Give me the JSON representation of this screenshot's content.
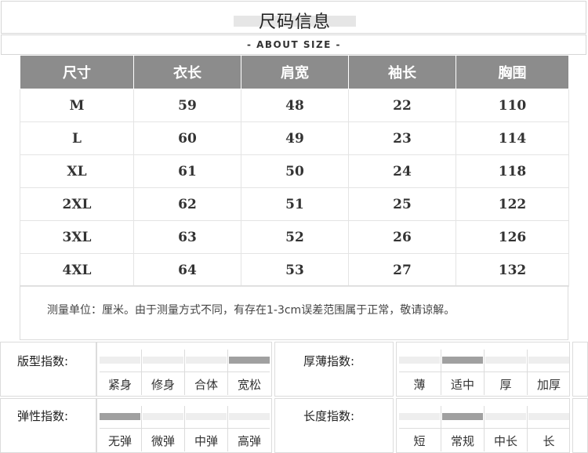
{
  "header": {
    "title": "尺码信息",
    "subtitle": "- ABOUT SIZE -"
  },
  "table": {
    "columns": [
      "尺寸",
      "衣长",
      "肩宽",
      "袖长",
      "胸围"
    ],
    "rows": [
      [
        "M",
        "59",
        "48",
        "22",
        "110"
      ],
      [
        "L",
        "60",
        "49",
        "23",
        "114"
      ],
      [
        "XL",
        "61",
        "50",
        "24",
        "118"
      ],
      [
        "2XL",
        "62",
        "51",
        "25",
        "122"
      ],
      [
        "3XL",
        "63",
        "52",
        "26",
        "126"
      ],
      [
        "4XL",
        "64",
        "53",
        "27",
        "132"
      ]
    ]
  },
  "note": "测量单位：厘米。由于测量方式不同，有存在1-3cm误差范围属于正常，敬请谅解。",
  "indices": [
    {
      "label": "版型指数:",
      "options": [
        "紧身",
        "修身",
        "合体",
        "宽松"
      ],
      "selected": 3
    },
    {
      "label": "厚薄指数:",
      "options": [
        "薄",
        "适中",
        "厚",
        "加厚"
      ],
      "selected": 1
    },
    {
      "label": "弹性指数:",
      "options": [
        "无弹",
        "微弹",
        "中弹",
        "高弹"
      ],
      "selected": 0
    },
    {
      "label": "长度指数:",
      "options": [
        "短",
        "常规",
        "中长",
        "长"
      ],
      "selected": 1
    }
  ]
}
